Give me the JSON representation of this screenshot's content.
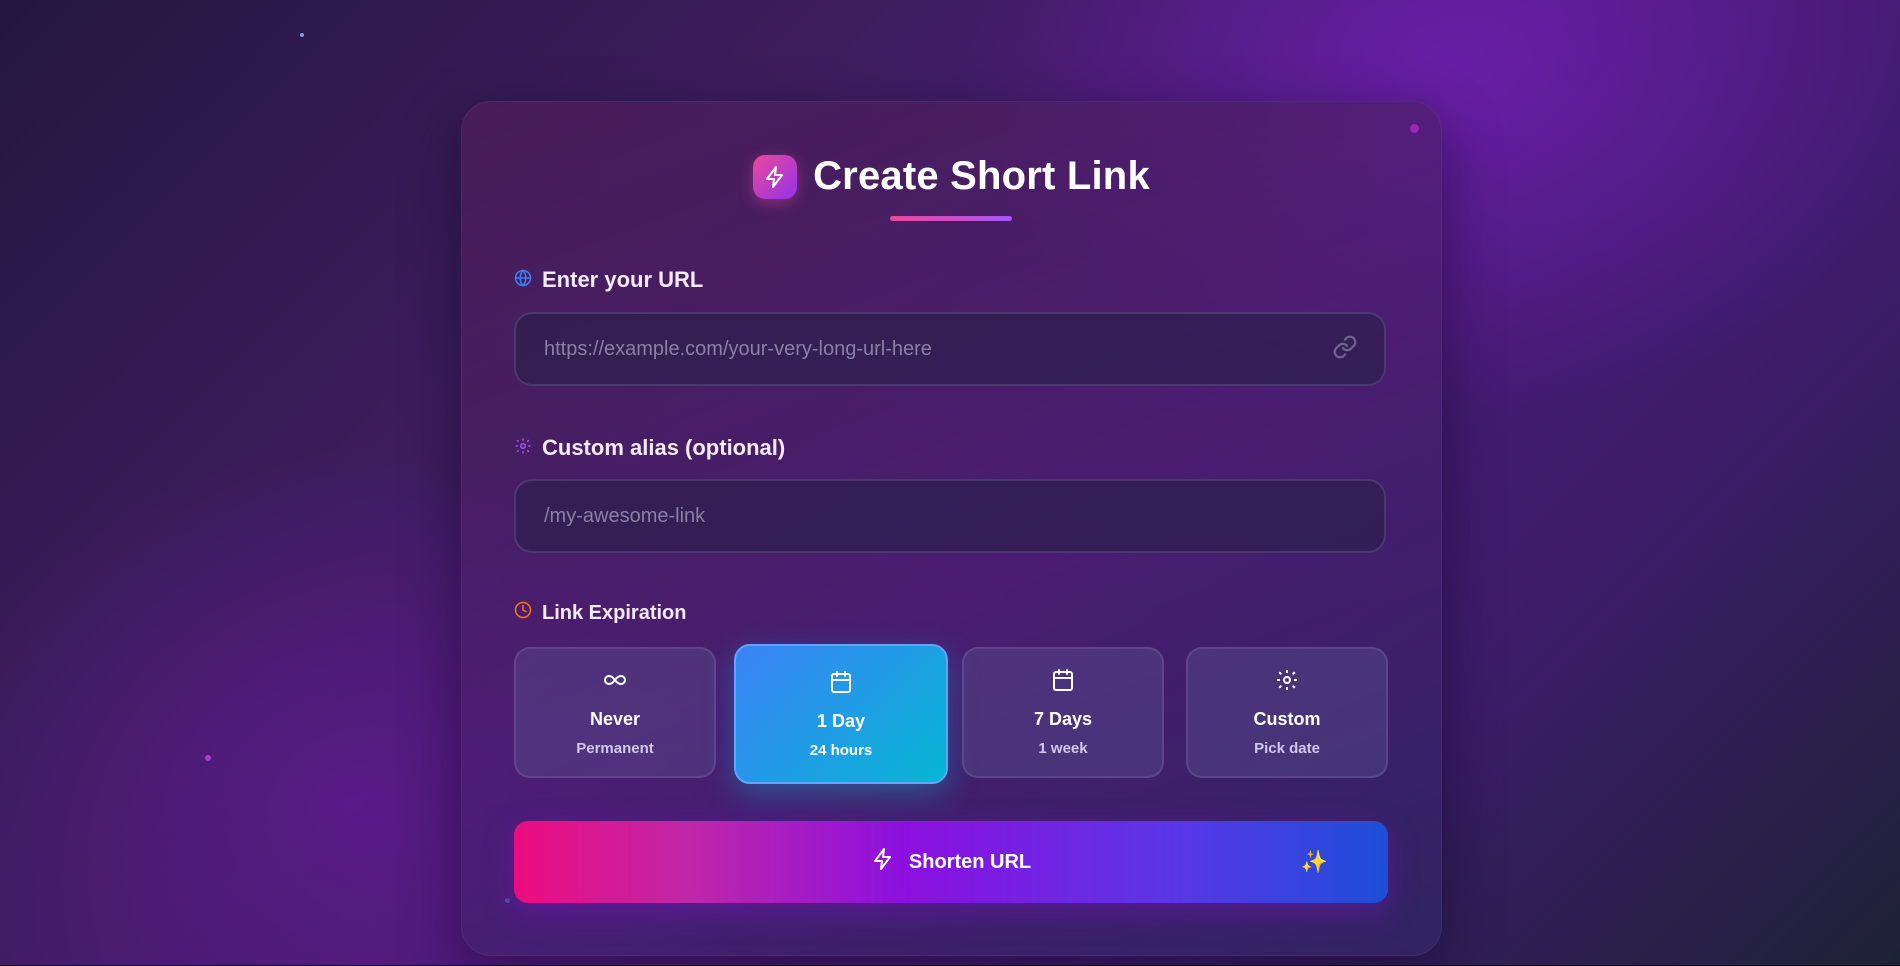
{
  "header": {
    "title": "Create Short Link",
    "logo_icon": "lightning-icon"
  },
  "url_field": {
    "label": "Enter your URL",
    "label_icon": "globe-icon",
    "placeholder": "https://example.com/your-very-long-url-here",
    "value": "",
    "trailing_icon": "link-icon"
  },
  "alias_field": {
    "label": "Custom alias (optional)",
    "label_icon": "gear-icon",
    "placeholder": "/my-awesome-link",
    "value": ""
  },
  "expiration": {
    "label": "Link Expiration",
    "label_icon": "clock-icon",
    "selected": "1 Day",
    "options": [
      {
        "title": "Never",
        "subtitle": "Permanent",
        "icon": "infinity-icon"
      },
      {
        "title": "1 Day",
        "subtitle": "24 hours",
        "icon": "calendar-icon"
      },
      {
        "title": "7 Days",
        "subtitle": "1 week",
        "icon": "calendar-icon"
      },
      {
        "title": "Custom",
        "subtitle": "Pick date",
        "icon": "gear-icon"
      }
    ]
  },
  "submit": {
    "label": "Shorten URL",
    "icon": "lightning-icon",
    "decoration": "✨"
  },
  "colors": {
    "accent_pink": "#ec4899",
    "accent_purple": "#a855f7",
    "selected_start": "#3b82f6",
    "selected_end": "#06b6d4",
    "button_start": "#ec0c7f",
    "button_end": "#1d4ed8"
  }
}
